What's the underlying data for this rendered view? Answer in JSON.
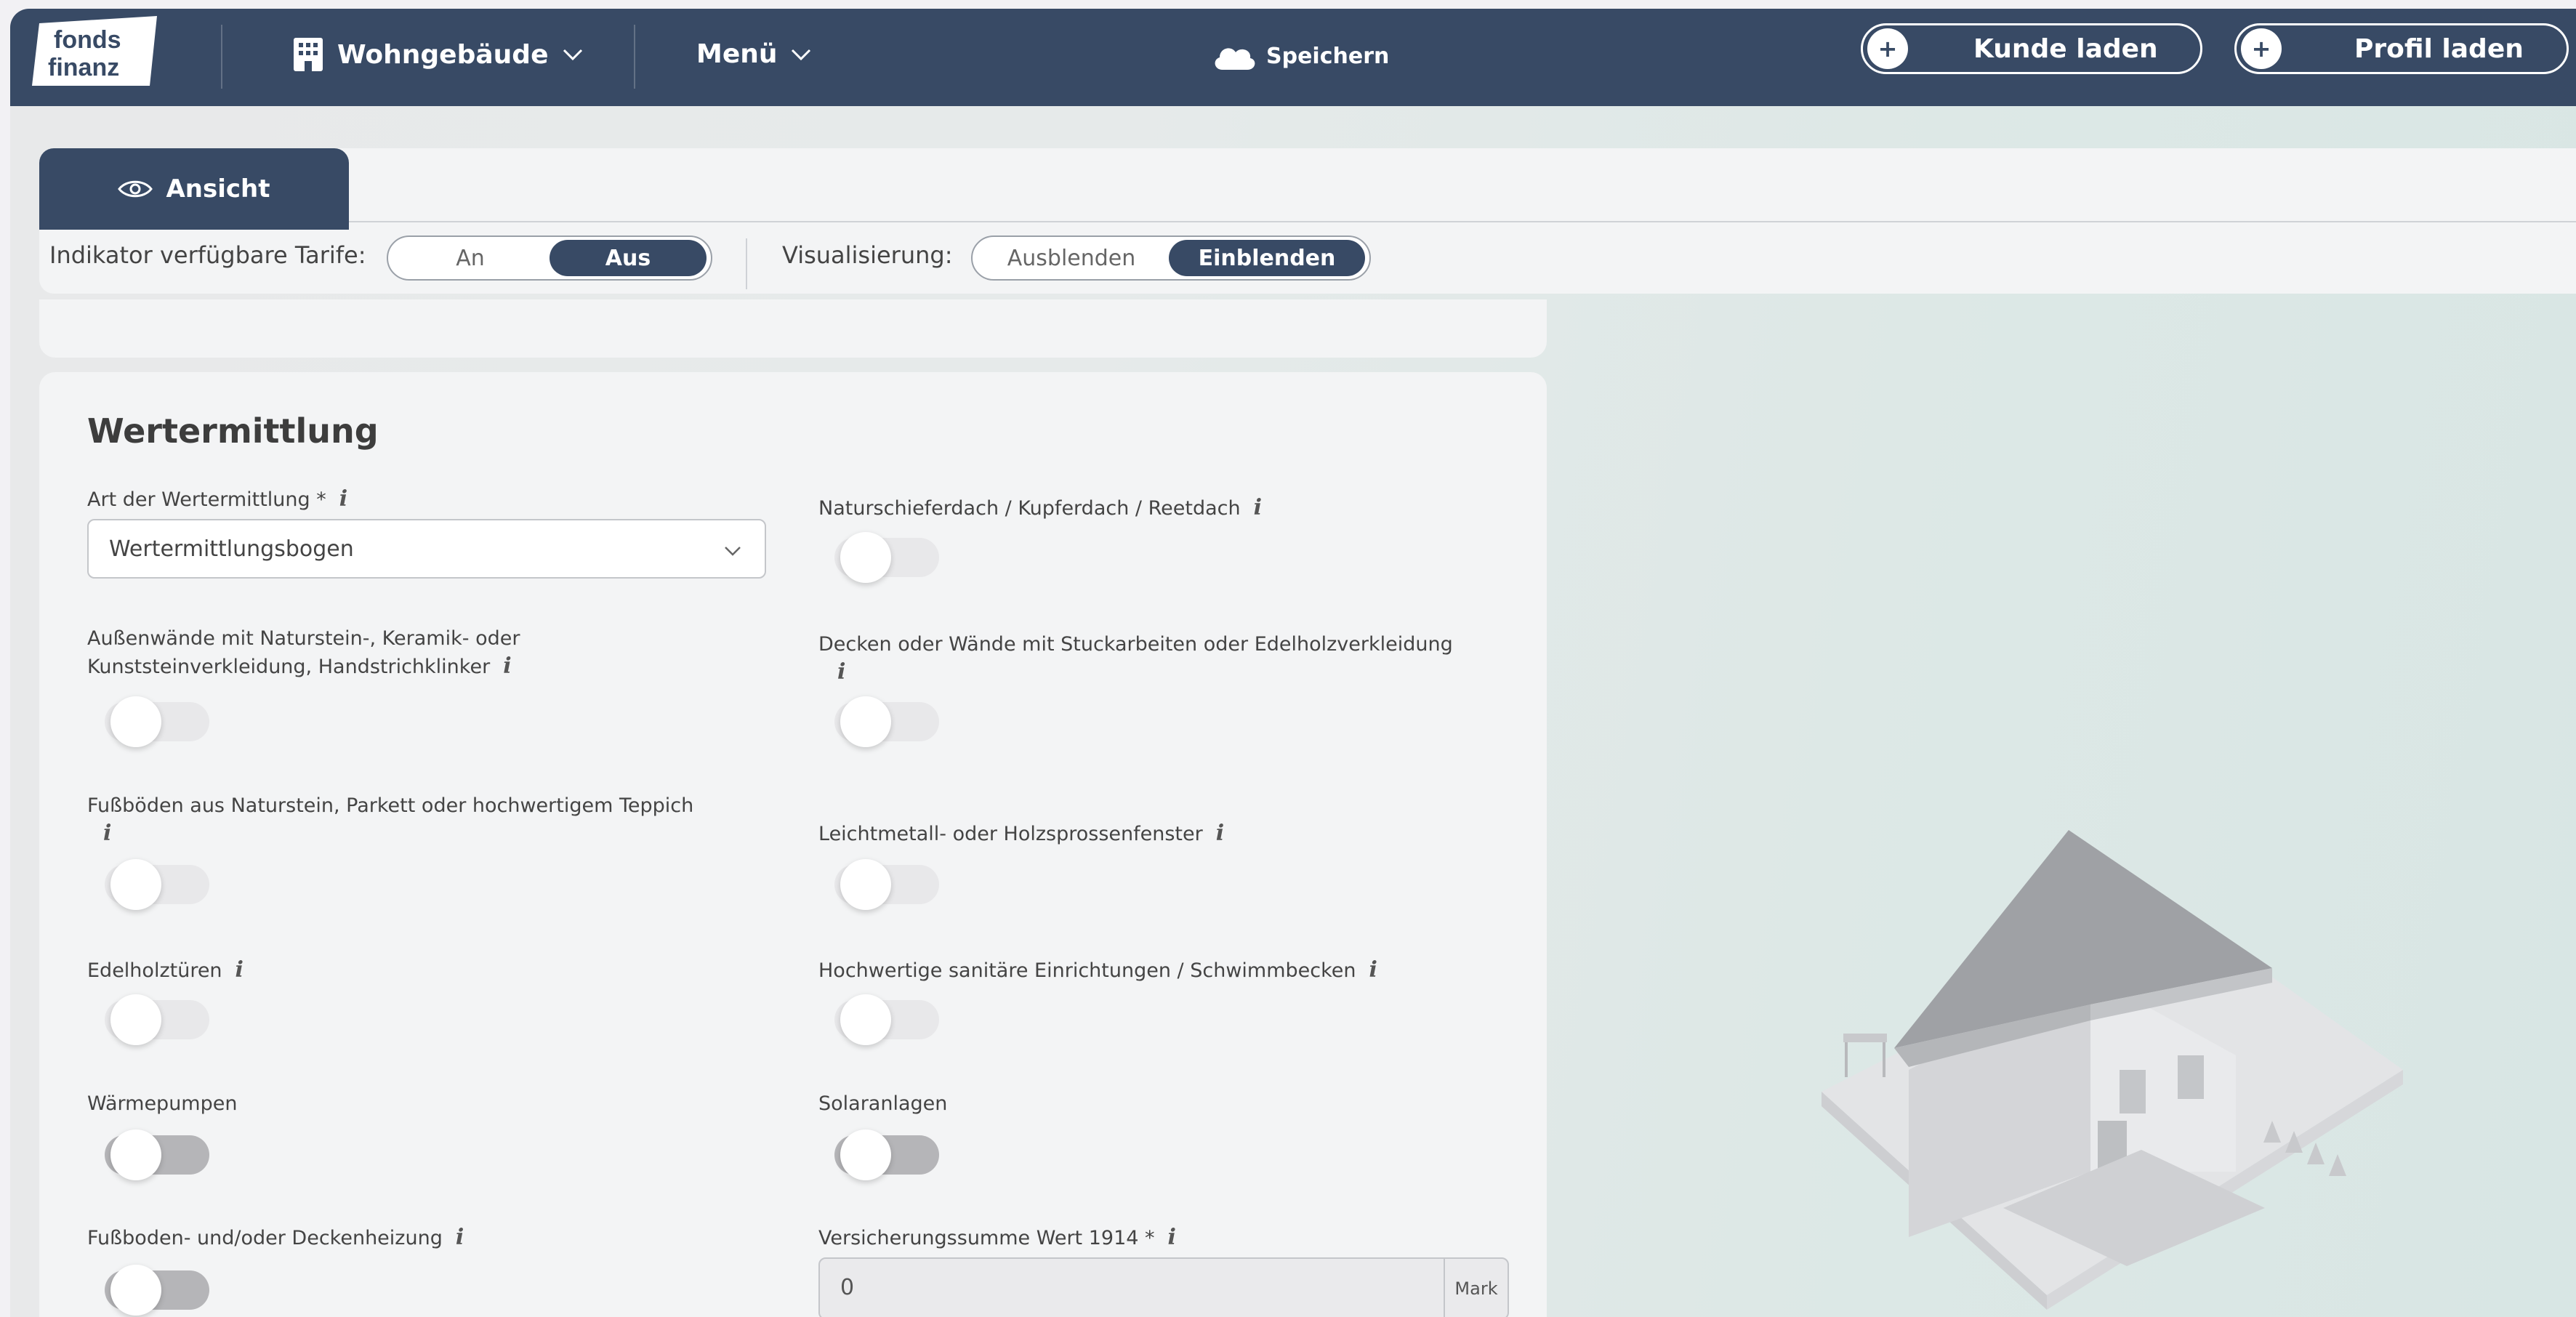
{
  "topbar": {
    "logo_line1": "fonds",
    "logo_line2": "finanz",
    "product": "Wohngebäude",
    "menu": "Menü",
    "save": "Speichern",
    "load_customer": "Kunde laden",
    "load_profile": "Profil laden"
  },
  "view": {
    "tab": "Ansicht",
    "indicator_label": "Indikator verfügbare Tarife:",
    "indicator_on": "An",
    "indicator_off": "Aus",
    "indicator_selected": "Aus",
    "visual_label": "Visualisierung:",
    "visual_hide": "Ausblenden",
    "visual_show": "Einblenden",
    "visual_selected": "Einblenden"
  },
  "valuation": {
    "title": "Wertermittlung",
    "type_label": "Art der Wertermittlung *",
    "type_value": "Wertermittlungsbogen",
    "fields": [
      {
        "label": "Naturschieferdach / Kupferdach / Reetdach",
        "on": false
      },
      {
        "label_line1": "Außenwände mit Naturstein-, Keramik- oder",
        "label_line2": "Kunststeinverkleidung, Handstrichklinker",
        "on": false
      },
      {
        "label": "Decken oder Wände mit Stuckarbeiten oder Edelholzverkleidung",
        "on": false
      },
      {
        "label": "Fußböden aus Naturstein, Parkett oder hochwertigem Teppich",
        "on": false
      },
      {
        "label": "Leichtmetall- oder Holzsprossenfenster",
        "on": false
      },
      {
        "label": "Edelholztüren",
        "on": false
      },
      {
        "label": "Hochwertige sanitäre Einrichtungen / Schwimmbecken",
        "on": false
      },
      {
        "label": "Wärmepumpen",
        "on": false
      },
      {
        "label": "Solaranlagen",
        "on": false
      },
      {
        "label": "Fußboden- und/oder Deckenheizung",
        "on": false
      }
    ],
    "sum_label": "Versicherungssumme Wert 1914 *",
    "sum_value": "0",
    "sum_unit": "Mark"
  },
  "colors": {
    "brand": "#384a65",
    "panel": "#f3f4f5"
  }
}
